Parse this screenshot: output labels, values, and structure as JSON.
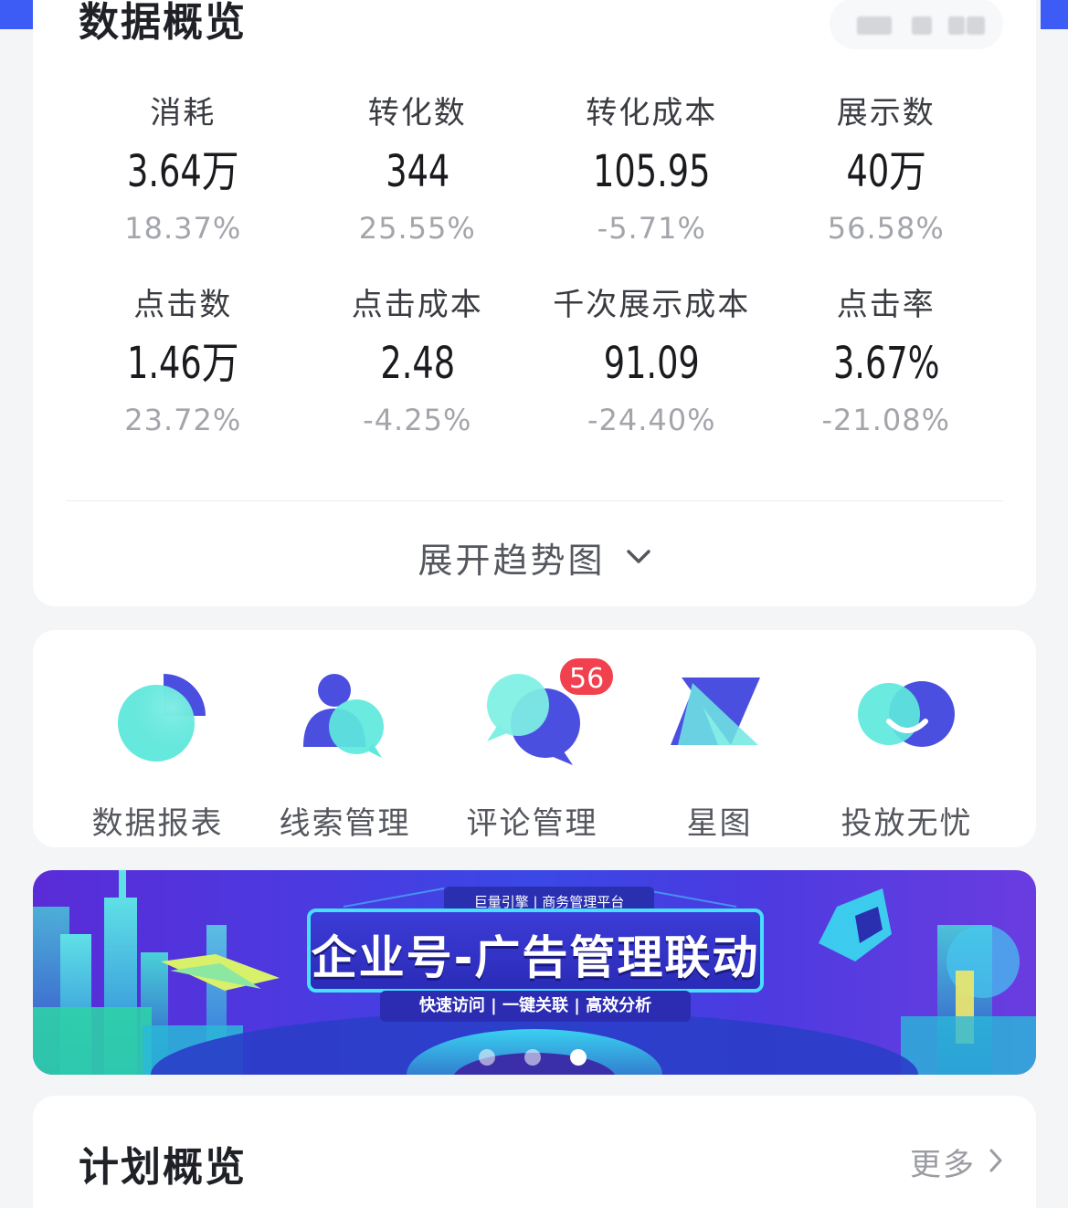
{
  "overview": {
    "title": "数据概览",
    "metrics": [
      {
        "label": "消耗",
        "value": "3.64万",
        "change": "18.37%"
      },
      {
        "label": "转化数",
        "value": "344",
        "change": "25.55%"
      },
      {
        "label": "转化成本",
        "value": "105.95",
        "change": "-5.71%"
      },
      {
        "label": "展示数",
        "value": "40万",
        "change": "56.58%"
      },
      {
        "label": "点击数",
        "value": "1.46万",
        "change": "23.72%"
      },
      {
        "label": "点击成本",
        "value": "2.48",
        "change": "-4.25%"
      },
      {
        "label": "千次展示成本",
        "value": "91.09",
        "change": "-24.40%"
      },
      {
        "label": "点击率",
        "value": "3.67%",
        "change": "-21.08%"
      }
    ],
    "expand_label": "展开趋势图"
  },
  "tools": {
    "items": [
      {
        "label": "数据报表",
        "icon": "pie-chart-icon"
      },
      {
        "label": "线索管理",
        "icon": "users-icon"
      },
      {
        "label": "评论管理",
        "icon": "comments-icon",
        "badge": "56"
      },
      {
        "label": "星图",
        "icon": "star-map-icon"
      },
      {
        "label": "投放无忧",
        "icon": "smile-icon"
      }
    ]
  },
  "banner": {
    "brand": "巨量引擎 | 商务管理平台",
    "title": "企业号-广告管理联动",
    "subtitle": "快速访问 | 一键关联 | 高效分析"
  },
  "plan": {
    "title": "计划概览",
    "more_label": "更多"
  },
  "colors": {
    "accent_blue": "#3d5cf5",
    "tool_purple": "#4b4fe0",
    "tool_cyan": "#5ee8dc",
    "badge_red": "#f2414e"
  }
}
